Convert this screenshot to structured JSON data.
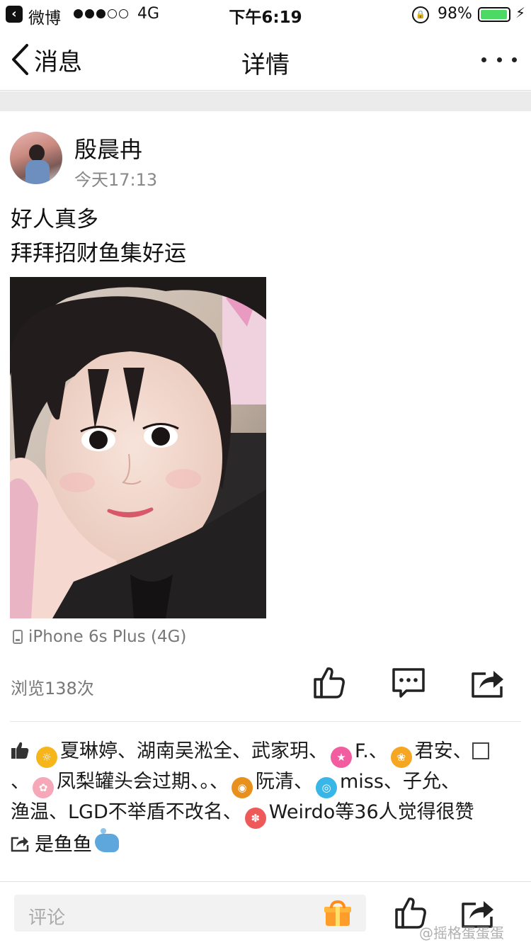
{
  "status_bar": {
    "back_app": "微博",
    "network": "4G",
    "time": "下午6:19",
    "battery": "98%",
    "battery_level": 0.98
  },
  "nav": {
    "back_label": "消息",
    "title": "详情",
    "more_icon": "ellipsis-icon"
  },
  "post": {
    "author": "殷晨冉",
    "time": "今天17:13",
    "text_line1": "好人真多",
    "text_line2": "拜拜招财鱼集好运",
    "device": "iPhone 6s Plus (4G)",
    "views": "浏览138次"
  },
  "likes": {
    "names": [
      "夏琳婷、湖南吴淞全、武家玥、",
      "F.、",
      "君安、",
      "、",
      "凤梨罐头会过期、。、",
      "阮清、",
      "miss、子允、",
      "渔温、LGD不举盾不改名、",
      "Weirdo等36人觉得很赞"
    ],
    "badge_colors": [
      "#f5b51b",
      "#f25da0",
      "#f5a623",
      "#f7a8b8",
      "#e8901c",
      "#38b6e8",
      "#ee5a5a"
    ]
  },
  "repost": {
    "user": "是鱼鱼"
  },
  "bottom": {
    "comment_placeholder": "评论",
    "watermark": "@摇格蛋蛋蛋"
  },
  "colors": {
    "battery": "#4cd964",
    "gift": "#ff9d2b",
    "divider": "#e6e6e6"
  }
}
